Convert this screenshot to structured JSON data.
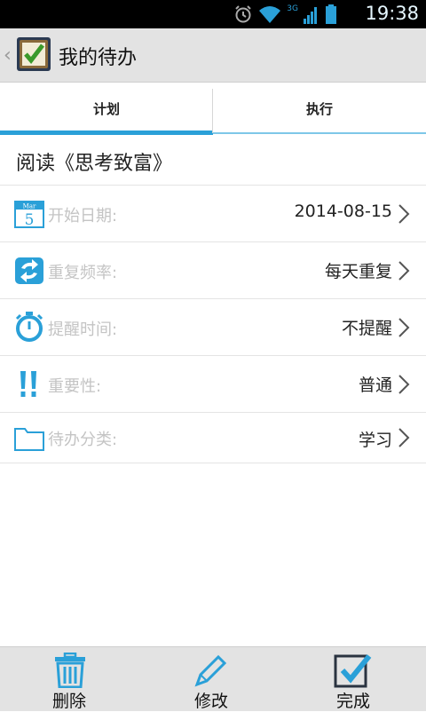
{
  "status_bar": {
    "time": "19:38",
    "network_label": "3G",
    "icons": [
      "alarm-icon",
      "wifi-icon",
      "signal-icon",
      "battery-icon"
    ]
  },
  "action_bar": {
    "back_glyph": "‹",
    "title": "我的待办",
    "app_icon": "todo-checkbox-icon"
  },
  "tabs": [
    {
      "label": "计划",
      "selected": true
    },
    {
      "label": "执行",
      "selected": false
    }
  ],
  "task": {
    "name": "阅读《思考致富》"
  },
  "rows": [
    {
      "icon": "calendar-icon",
      "calendar_month": "Mar",
      "calendar_day": "5",
      "label": "开始日期:",
      "value": "2014-08-15"
    },
    {
      "icon": "repeat-icon",
      "label": "重复频率:",
      "value": "每天重复"
    },
    {
      "icon": "stopwatch-icon",
      "label": "提醒时间:",
      "value": "不提醒"
    },
    {
      "icon": "exclamation-icon",
      "label": "重要性:",
      "value": "普通"
    },
    {
      "icon": "folder-icon",
      "label": "待办分类:",
      "value": "学习"
    }
  ],
  "bottom_bar": [
    {
      "icon": "trash-icon",
      "label": "删除"
    },
    {
      "icon": "pencil-icon",
      "label": "修改"
    },
    {
      "icon": "checkbox-icon",
      "label": "完成"
    }
  ],
  "colors": {
    "accent": "#2aa0d8",
    "label_gray": "#c4c4c4",
    "bar_gray": "#e3e3e3"
  }
}
